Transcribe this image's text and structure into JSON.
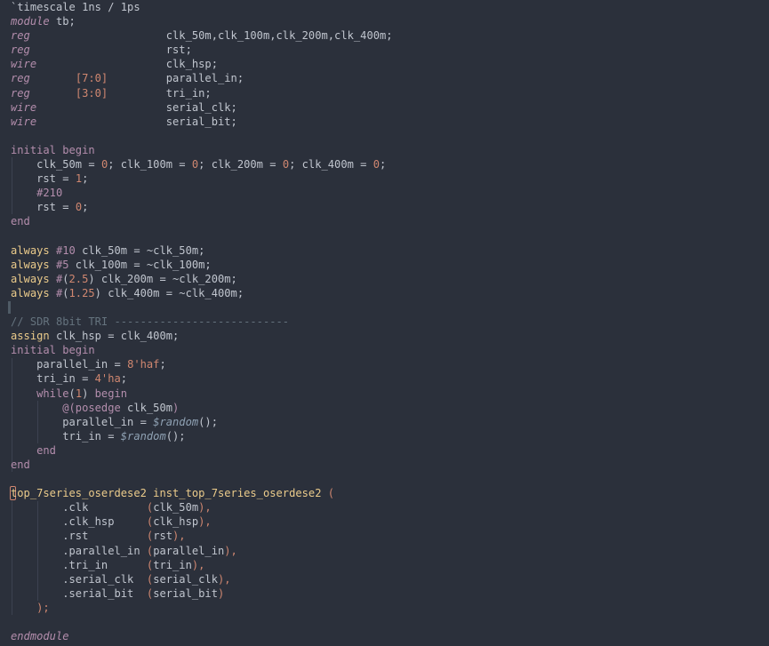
{
  "editor": {
    "language": "verilog",
    "theme_colors": {
      "background": "#2b303b",
      "text": "#c0c5ce",
      "keyword": "#b48ead",
      "number": "#d08770",
      "comment": "#65737e",
      "system_function": "#8fa1b3"
    },
    "lines": [
      [
        {
          "t": "`timescale 1ns / 1ps",
          "c": "plain"
        }
      ],
      [
        {
          "t": "module",
          "c": "type"
        },
        {
          "t": " tb;",
          "c": "plain"
        }
      ],
      [
        {
          "t": "reg",
          "c": "type"
        },
        {
          "t": "                     clk_50m,clk_100m,clk_200m,clk_400m;",
          "c": "plain"
        }
      ],
      [
        {
          "t": "reg",
          "c": "type"
        },
        {
          "t": "                     rst;",
          "c": "plain"
        }
      ],
      [
        {
          "t": "wire",
          "c": "type"
        },
        {
          "t": "                    clk_hsp;",
          "c": "plain"
        }
      ],
      [
        {
          "t": "reg",
          "c": "type"
        },
        {
          "t": "       ",
          "c": "plain"
        },
        {
          "t": "[7:0]",
          "c": "number"
        },
        {
          "t": "         parallel_in;",
          "c": "plain"
        }
      ],
      [
        {
          "t": "reg",
          "c": "type"
        },
        {
          "t": "       ",
          "c": "plain"
        },
        {
          "t": "[3:0]",
          "c": "number"
        },
        {
          "t": "         tri_in;",
          "c": "plain"
        }
      ],
      [
        {
          "t": "wire",
          "c": "type"
        },
        {
          "t": "                    serial_clk;",
          "c": "plain"
        }
      ],
      [
        {
          "t": "wire",
          "c": "type"
        },
        {
          "t": "                    serial_bit;",
          "c": "plain"
        }
      ],
      [],
      [
        {
          "t": "initial begin",
          "c": "keyword"
        }
      ],
      [
        {
          "t": "    clk_50m = ",
          "c": "plain"
        },
        {
          "t": "0",
          "c": "number"
        },
        {
          "t": "; clk_100m = ",
          "c": "plain"
        },
        {
          "t": "0",
          "c": "number"
        },
        {
          "t": "; clk_200m = ",
          "c": "plain"
        },
        {
          "t": "0",
          "c": "number"
        },
        {
          "t": "; clk_400m = ",
          "c": "plain"
        },
        {
          "t": "0",
          "c": "number"
        },
        {
          "t": ";",
          "c": "plain"
        }
      ],
      [
        {
          "t": "    rst = ",
          "c": "plain"
        },
        {
          "t": "1",
          "c": "number"
        },
        {
          "t": ";",
          "c": "plain"
        }
      ],
      [
        {
          "t": "    ",
          "c": "plain"
        },
        {
          "t": "#210",
          "c": "keyword"
        }
      ],
      [
        {
          "t": "    rst = ",
          "c": "plain"
        },
        {
          "t": "0",
          "c": "number"
        },
        {
          "t": ";",
          "c": "plain"
        }
      ],
      [
        {
          "t": "end",
          "c": "keyword"
        }
      ],
      [],
      [
        {
          "t": "always",
          "c": "name"
        },
        {
          "t": " ",
          "c": "plain"
        },
        {
          "t": "#10",
          "c": "keyword"
        },
        {
          "t": " clk_50m = ~clk_50m;",
          "c": "plain"
        }
      ],
      [
        {
          "t": "always",
          "c": "name"
        },
        {
          "t": " ",
          "c": "plain"
        },
        {
          "t": "#5",
          "c": "keyword"
        },
        {
          "t": " clk_100m = ~clk_100m;",
          "c": "plain"
        }
      ],
      [
        {
          "t": "always",
          "c": "name"
        },
        {
          "t": " ",
          "c": "plain"
        },
        {
          "t": "#",
          "c": "keyword"
        },
        {
          "t": "(",
          "c": "plain"
        },
        {
          "t": "2.5",
          "c": "number"
        },
        {
          "t": ") clk_200m = ~clk_200m;",
          "c": "plain"
        }
      ],
      [
        {
          "t": "always",
          "c": "name"
        },
        {
          "t": " ",
          "c": "plain"
        },
        {
          "t": "#",
          "c": "keyword"
        },
        {
          "t": "(",
          "c": "plain"
        },
        {
          "t": "1.25",
          "c": "number"
        },
        {
          "t": ") clk_400m = ~clk_400m;",
          "c": "plain"
        }
      ],
      [],
      [
        {
          "t": "// SDR 8bit TRI ---------------------------",
          "c": "comment"
        }
      ],
      [
        {
          "t": "assign",
          "c": "name"
        },
        {
          "t": " clk_hsp = clk_400m;",
          "c": "plain"
        }
      ],
      [
        {
          "t": "initial begin",
          "c": "keyword"
        }
      ],
      [
        {
          "t": "    parallel_in = ",
          "c": "plain"
        },
        {
          "t": "8'haf",
          "c": "number"
        },
        {
          "t": ";",
          "c": "plain"
        }
      ],
      [
        {
          "t": "    tri_in = ",
          "c": "plain"
        },
        {
          "t": "4'ha",
          "c": "number"
        },
        {
          "t": ";",
          "c": "plain"
        }
      ],
      [
        {
          "t": "    ",
          "c": "plain"
        },
        {
          "t": "while",
          "c": "keyword"
        },
        {
          "t": "(",
          "c": "plain"
        },
        {
          "t": "1",
          "c": "number"
        },
        {
          "t": ") ",
          "c": "plain"
        },
        {
          "t": "begin",
          "c": "keyword"
        }
      ],
      [
        {
          "t": "        ",
          "c": "plain"
        },
        {
          "t": "@(posedge",
          "c": "keyword"
        },
        {
          "t": " clk_50m",
          "c": "plain"
        },
        {
          "t": ")",
          "c": "keyword"
        }
      ],
      [
        {
          "t": "        parallel_in = ",
          "c": "plain"
        },
        {
          "t": "$random",
          "c": "sysfunc"
        },
        {
          "t": "();",
          "c": "plain"
        }
      ],
      [
        {
          "t": "        tri_in = ",
          "c": "plain"
        },
        {
          "t": "$random",
          "c": "sysfunc"
        },
        {
          "t": "();",
          "c": "plain"
        }
      ],
      [
        {
          "t": "    ",
          "c": "plain"
        },
        {
          "t": "end",
          "c": "keyword"
        }
      ],
      [
        {
          "t": "end",
          "c": "keyword"
        }
      ],
      [],
      [
        {
          "t": "top_7series_oserdese2 inst_top_7series_oserdese2 ",
          "c": "name"
        },
        {
          "t": "(",
          "c": "paren"
        }
      ],
      [
        {
          "t": "        .clk         ",
          "c": "plain"
        },
        {
          "t": "(",
          "c": "paren"
        },
        {
          "t": "clk_50m",
          "c": "plain"
        },
        {
          "t": "),",
          "c": "paren"
        }
      ],
      [
        {
          "t": "        .clk_hsp     ",
          "c": "plain"
        },
        {
          "t": "(",
          "c": "paren"
        },
        {
          "t": "clk_hsp",
          "c": "plain"
        },
        {
          "t": "),",
          "c": "paren"
        }
      ],
      [
        {
          "t": "        .rst         ",
          "c": "plain"
        },
        {
          "t": "(",
          "c": "paren"
        },
        {
          "t": "rst",
          "c": "plain"
        },
        {
          "t": "),",
          "c": "paren"
        }
      ],
      [
        {
          "t": "        .parallel_in ",
          "c": "plain"
        },
        {
          "t": "(",
          "c": "paren"
        },
        {
          "t": "parallel_in",
          "c": "plain"
        },
        {
          "t": "),",
          "c": "paren"
        }
      ],
      [
        {
          "t": "        .tri_in      ",
          "c": "plain"
        },
        {
          "t": "(",
          "c": "paren"
        },
        {
          "t": "tri_in",
          "c": "plain"
        },
        {
          "t": "),",
          "c": "paren"
        }
      ],
      [
        {
          "t": "        .serial_clk  ",
          "c": "plain"
        },
        {
          "t": "(",
          "c": "paren"
        },
        {
          "t": "serial_clk",
          "c": "plain"
        },
        {
          "t": "),",
          "c": "paren"
        }
      ],
      [
        {
          "t": "        .serial_bit  ",
          "c": "plain"
        },
        {
          "t": "(",
          "c": "paren"
        },
        {
          "t": "serial_bit",
          "c": "plain"
        },
        {
          "t": ")",
          "c": "paren"
        }
      ],
      [
        {
          "t": "    ",
          "c": "plain"
        },
        {
          "t": ");",
          "c": "paren"
        }
      ],
      [],
      [
        {
          "t": "endmodule",
          "c": "type"
        }
      ]
    ]
  }
}
